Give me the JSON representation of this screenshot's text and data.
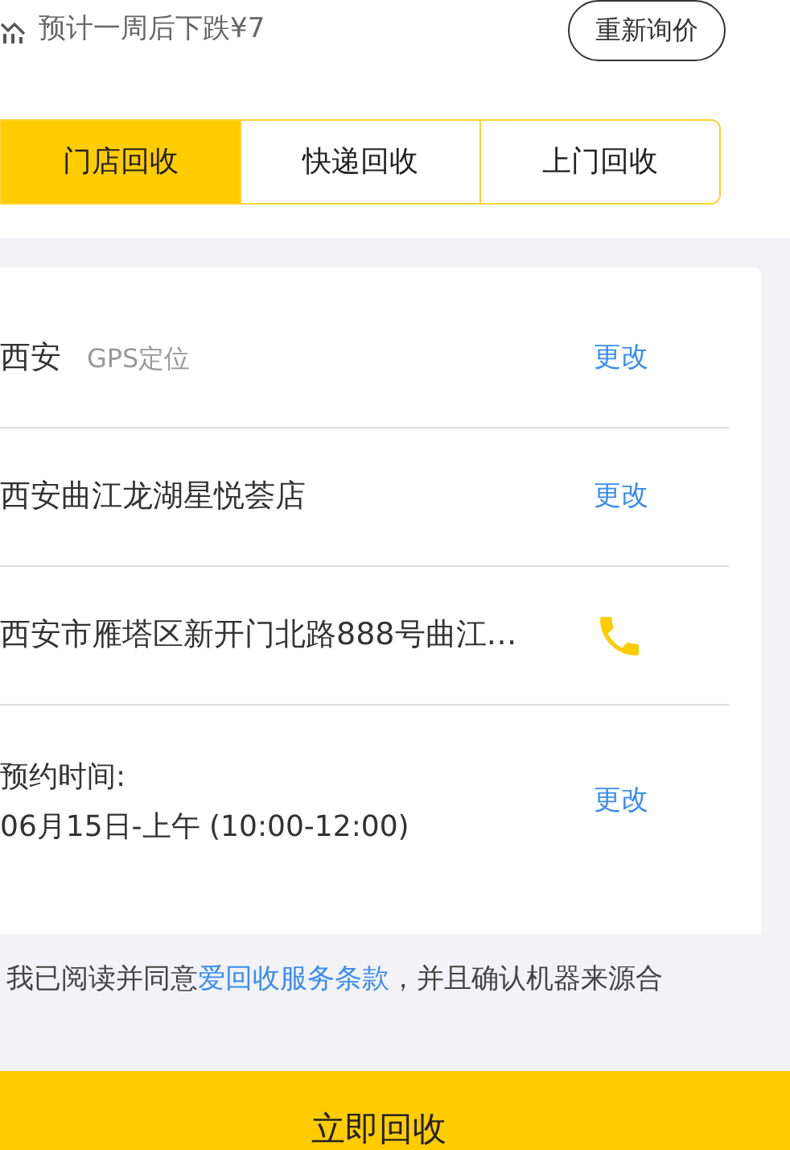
{
  "forecast": {
    "text": "预计一周后下跌¥7",
    "button": "重新询价"
  },
  "tabs": [
    {
      "label": "门店回收",
      "selected": true
    },
    {
      "label": "快递回收",
      "selected": false
    },
    {
      "label": "上门回收",
      "selected": false
    }
  ],
  "rows": [
    {
      "kind": "city",
      "text": "西安",
      "note": "GPS定位",
      "action": "更改"
    },
    {
      "kind": "store",
      "text": "西安曲江龙湖星悦荟店",
      "action": "更改"
    },
    {
      "kind": "address",
      "text": "西安市雁塔区新开门北路888号曲江…"
    },
    {
      "kind": "time",
      "label": "预约时间:",
      "text": "06月15日-上午 (10:00-12:00)",
      "action": "更改"
    }
  ],
  "agreement": {
    "before": "我已阅读并同意",
    "link": "爱回收服务条款",
    "after": "，并且确认机器来源合"
  },
  "submit": "立即回收"
}
